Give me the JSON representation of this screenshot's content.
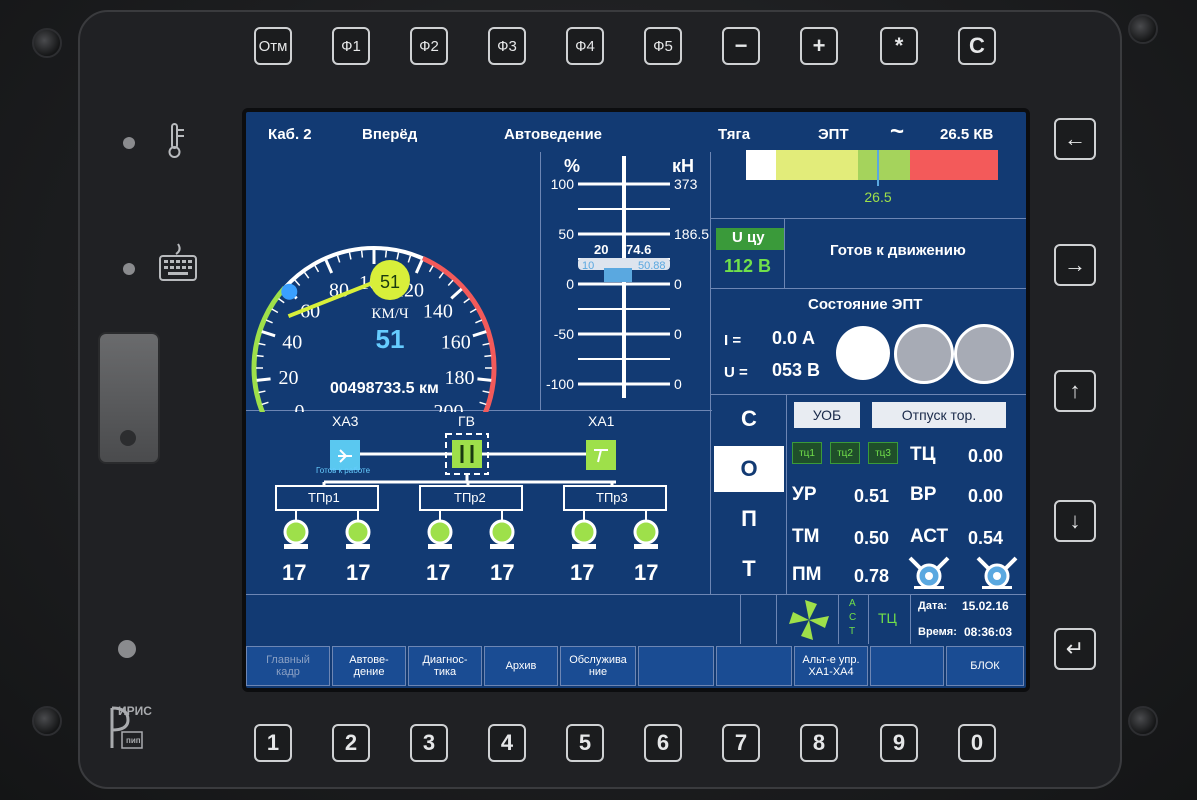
{
  "top_keys": [
    "Отм",
    "Ф1",
    "Ф2",
    "Ф3",
    "Ф4",
    "Ф5",
    "−",
    "+",
    "*",
    "С"
  ],
  "bottom_keys": [
    "1",
    "2",
    "3",
    "4",
    "5",
    "6",
    "7",
    "8",
    "9",
    "0"
  ],
  "side_keys": [
    "←",
    "→",
    "↑",
    "↓",
    "↵"
  ],
  "logo_text": "ИРИС",
  "logo_sub": "пип",
  "header": {
    "cab": "Каб. 2",
    "direction": "Вперёд",
    "mode": "Автоведение",
    "traction": "Тяга",
    "ept": "ЭПТ",
    "ac_symbol": "~",
    "voltage": "26.5 КВ"
  },
  "speedometer": {
    "ticks": [
      "0",
      "20",
      "40",
      "60",
      "80",
      "100",
      "120",
      "140",
      "160",
      "180",
      "200"
    ],
    "set_speed": "51",
    "unit": "КМ/Ч",
    "actual_speed": "51",
    "odometer": "00498733.5 км",
    "needle_speed": 51,
    "max": 200
  },
  "force_scale": {
    "left_unit": "%",
    "right_unit": "кН",
    "left_ticks": [
      "100",
      "50",
      "0",
      "-50",
      "-100"
    ],
    "right_ticks": [
      "373",
      "186.5",
      "0",
      "0",
      "0"
    ],
    "value_left": "20",
    "value_right": "74.6",
    "value_left2": "10",
    "value_right2": "50.88"
  },
  "voltage_bar": {
    "marker_label": "26.5",
    "colors": {
      "white": "#ffffff",
      "yellow": "#e2ec7a",
      "green": "#a5d35c",
      "red": "#f35a5a"
    }
  },
  "u_cu": {
    "label": "U цу",
    "value": "112 В"
  },
  "ready_text": "Готов к движению",
  "ept_state": {
    "title": "Состояние ЭПТ",
    "i_label": "I =",
    "i_value": "0.0 А",
    "u_label": "U =",
    "u_value": "053 В"
  },
  "circuit": {
    "xa3": "ХА3",
    "gv": "ГВ",
    "xa1": "ХА1",
    "ready_small": "Готов к работе",
    "tpr": [
      "ТПр1",
      "ТПр2",
      "ТПр3"
    ],
    "motors": [
      "17",
      "17",
      "17",
      "17",
      "17",
      "17"
    ]
  },
  "modes": [
    "С",
    "О",
    "П",
    "Т"
  ],
  "brake_buttons": {
    "uob": "УОБ",
    "release": "Отпуск тор."
  },
  "tc_small": [
    "тц1",
    "тц2",
    "тц3"
  ],
  "pressures": [
    {
      "label": "ТЦ",
      "value": "0.00"
    },
    {
      "label": "УР",
      "value": "0.51"
    },
    {
      "label": "ВР",
      "value": "0.00"
    },
    {
      "label": "ТМ",
      "value": "0.50"
    },
    {
      "label": "АСТ",
      "value": "0.54"
    },
    {
      "label": "ПМ",
      "value": "0.78"
    }
  ],
  "status_bar": {
    "ast_vertical": [
      "А",
      "С",
      "Т"
    ],
    "tc": "ТЦ",
    "date_label": "Дата:",
    "date": "15.02.16",
    "time_label": "Время:",
    "time": "08:36:03"
  },
  "softkeys": [
    {
      "label": "Главный кадр",
      "line1": "Главный",
      "line2": "кадр",
      "active": false
    },
    {
      "line1": "Автове-",
      "line2": "дение"
    },
    {
      "line1": "Диагнос-",
      "line2": "тика"
    },
    {
      "line1": "Архив",
      "line2": ""
    },
    {
      "line1": "Обслужива",
      "line2": "ние"
    },
    {
      "line1": "",
      "line2": ""
    },
    {
      "line1": "",
      "line2": ""
    },
    {
      "line1": "Альт-е упр.",
      "line2": "ХА1-ХА4"
    },
    {
      "line1": "",
      "line2": ""
    },
    {
      "line1": "БЛОК",
      "line2": ""
    }
  ]
}
